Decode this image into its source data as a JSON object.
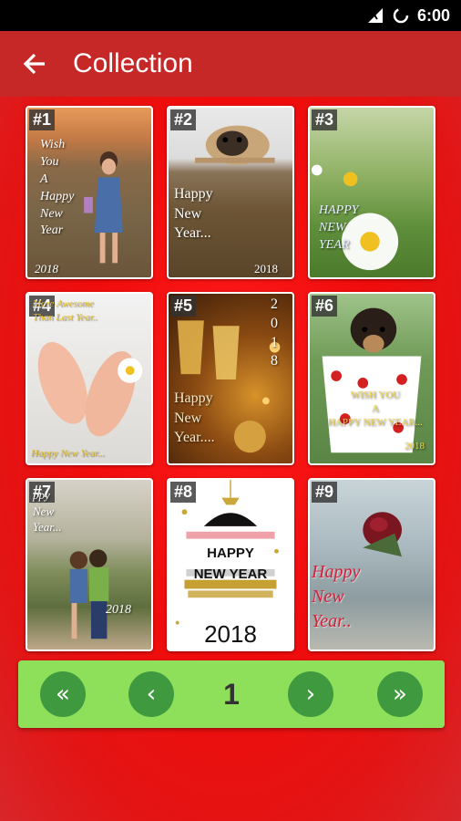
{
  "status_bar": {
    "time": "6:00"
  },
  "app_bar": {
    "title": "Collection",
    "back_icon": "arrow-left-icon"
  },
  "cards": [
    {
      "badge": "#1",
      "lines": [
        "Wish\nYou\nA\nHappy\nNew\nYear"
      ],
      "year": "2018"
    },
    {
      "badge": "#2",
      "lines": [
        "Happy\n   New\n      Year..."
      ],
      "year": "2018"
    },
    {
      "badge": "#3",
      "lines": [
        "HAPPY\nNEW\nYEAR"
      ],
      "year": ""
    },
    {
      "badge": "#4",
      "lines": [
        "More Awesome\nThan Last Year.."
      ],
      "year": "Happy New Year..."
    },
    {
      "badge": "#5",
      "lines": [
        "Happy\n   New\n      Year...."
      ],
      "year": "2\n0\n1\n8"
    },
    {
      "badge": "#6",
      "lines": [
        "WISH YOU\nA\nHAPPY NEW YEAR..."
      ],
      "year": "2018"
    },
    {
      "badge": "#7",
      "lines": [
        "ppy\nNew\nYear..."
      ],
      "year": "2018"
    },
    {
      "badge": "#8",
      "lines": [
        "HAPPY\nNEW YEAR"
      ],
      "year": "2018"
    },
    {
      "badge": "#9",
      "lines": [
        "Happy\n  New\n      Year.."
      ],
      "year": ""
    }
  ],
  "pager": {
    "first": "«",
    "prev": "‹",
    "page": "1",
    "next": "›",
    "last": "»"
  }
}
